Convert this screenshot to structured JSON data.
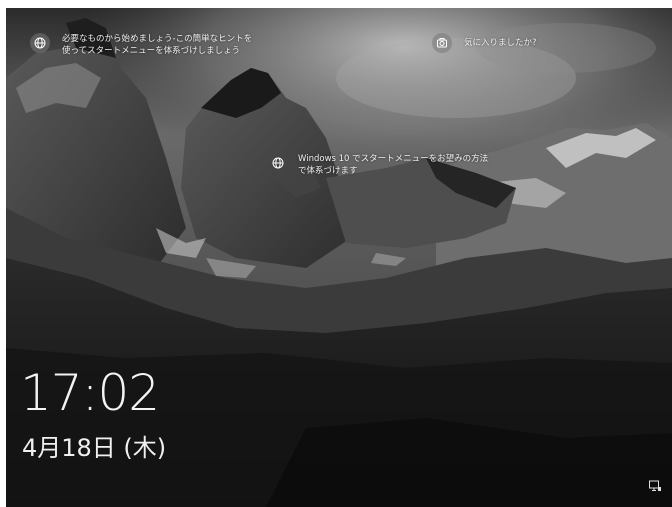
{
  "hotspots": [
    {
      "icon": "globe-icon",
      "text": "必要なものから始めましょう-この簡単なヒントを\n使ってスタートメニューを体系づけしましょう"
    },
    {
      "icon": "camera-icon",
      "text": "気に入りましたか?"
    },
    {
      "icon": "globe-icon",
      "text": "Windows 10 でスタートメニューをお望みの方法\nで体系づけます"
    }
  ],
  "clock": {
    "time": "17:02",
    "date": "4月18日 (木)"
  },
  "status": {
    "network_icon": "network-icon"
  }
}
